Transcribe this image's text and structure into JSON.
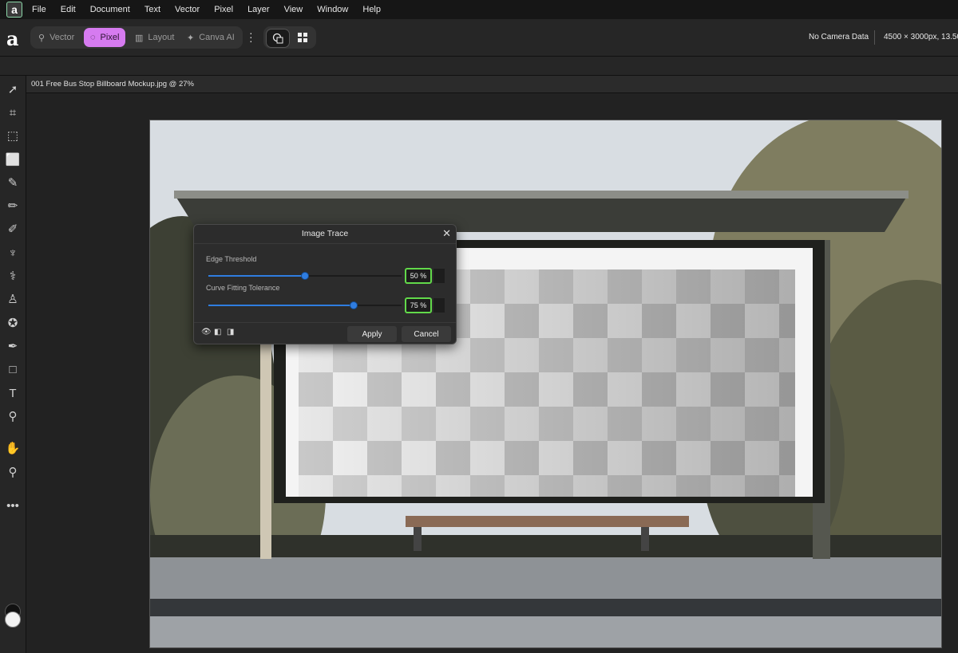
{
  "app": {
    "logo_letter": "a"
  },
  "menu": [
    "File",
    "Edit",
    "Document",
    "Text",
    "Vector",
    "Pixel",
    "Layer",
    "View",
    "Window",
    "Help"
  ],
  "toolbar": {
    "brand": "a",
    "personas": [
      {
        "label": "Vector",
        "icon": "vector-persona-icon",
        "active": false
      },
      {
        "label": "Pixel",
        "icon": "pixel-persona-icon",
        "active": true
      },
      {
        "label": "Layout",
        "icon": "layout-persona-icon",
        "active": false
      },
      {
        "label": "Canva AI",
        "icon": "canva-ai-icon",
        "active": false
      }
    ],
    "camera_data": "No Camera Data",
    "image_info": "4500 × 3000px, 13.50"
  },
  "document": {
    "tab_title": "001 Free Bus Stop Billboard Mockup.jpg @ 27%"
  },
  "dialog": {
    "title": "Image Trace",
    "edge_threshold": {
      "label": "Edge Threshold",
      "value": 50,
      "display": "50 %"
    },
    "curve_tolerance": {
      "label": "Curve Fitting Tolerance",
      "value": 75,
      "display": "75 %"
    },
    "apply_label": "Apply",
    "cancel_label": "Cancel"
  },
  "colors": {
    "accent_pixel": "#d67bf0",
    "slider": "#2f7de0",
    "focus_outline": "#62d94a"
  }
}
